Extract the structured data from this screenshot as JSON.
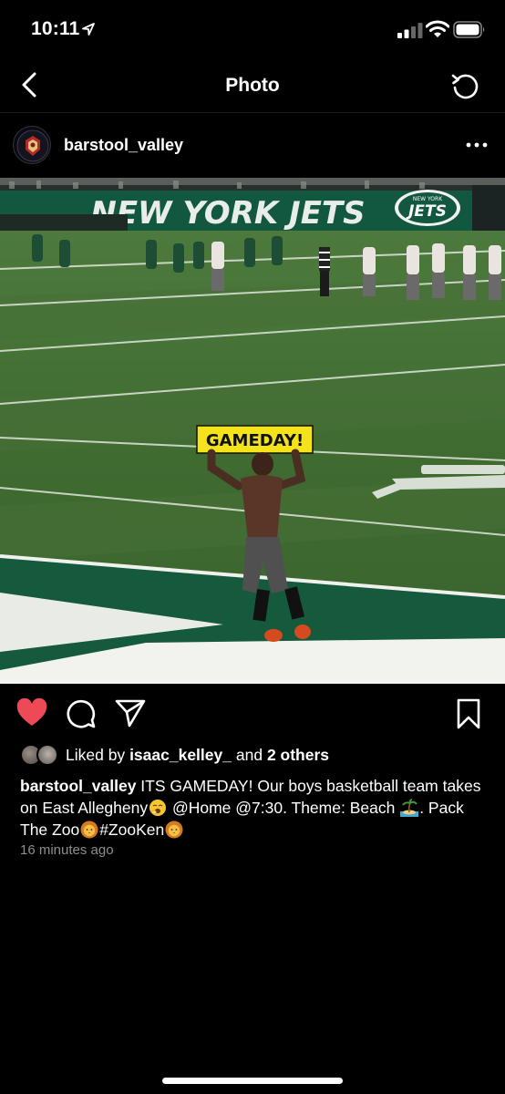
{
  "status_bar": {
    "time": "10:11",
    "icons": [
      "location-arrow-icon",
      "cellular-signal-icon",
      "wifi-icon",
      "battery-icon"
    ]
  },
  "nav": {
    "title": "Photo",
    "back_icon": "chevron-left-icon",
    "refresh_icon": "refresh-icon"
  },
  "post": {
    "username": "barstool_valley",
    "more_icon": "more-horizontal-icon",
    "photo": {
      "stadium_banner": "NEW YORK JETS",
      "jets_logo_line1": "NEW YORK",
      "jets_logo_line2": "JETS",
      "sign_text": "GAMEDAY!"
    },
    "actions": {
      "like_icon": "heart-icon",
      "comment_icon": "comment-icon",
      "share_icon": "paper-plane-icon",
      "save_icon": "bookmark-icon",
      "liked": true
    },
    "likes": {
      "prefix": "Liked by",
      "user": "isaac_kelley_",
      "connector": "and",
      "others": "2 others"
    },
    "caption": {
      "username": "barstool_valley",
      "part1": "ITS GAMEDAY! Our boys basketball team takes on East Allegheny",
      "part2": " @Home @7:30. Theme: Beach",
      "part3": ". Pack The Zoo",
      "part4": "#ZooKen"
    },
    "timestamp": "16 minutes ago"
  },
  "colors": {
    "background": "#000000",
    "like_red": "#ed4956",
    "secondary_text": "#8e8e8e",
    "jets_green": "#125740",
    "sign_yellow": "#f4e21b"
  }
}
